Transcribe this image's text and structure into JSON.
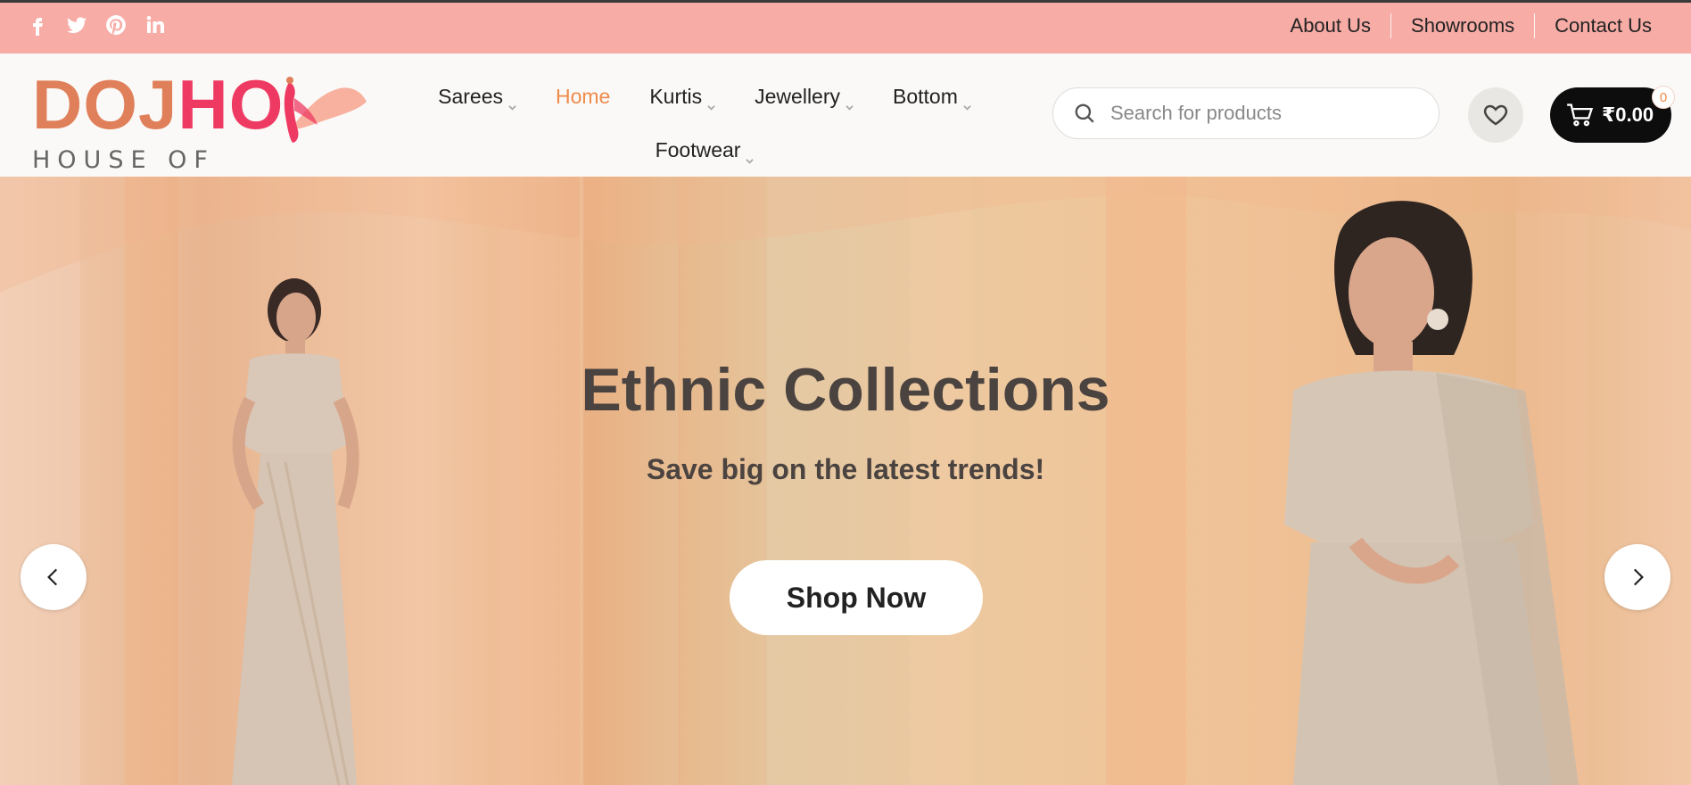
{
  "social": [
    "facebook-icon",
    "twitter-icon",
    "pinterest-icon",
    "linkedin-icon"
  ],
  "toplinks": [
    "About Us",
    "Showrooms",
    "Contact Us"
  ],
  "logo": {
    "main_part1": "DOJ",
    "main_part2": "HO",
    "subtitle": "HOUSE OF FASHION"
  },
  "nav": {
    "row1": [
      "Sarees",
      "Home",
      "Kurtis",
      "Jewellery",
      "Bottom"
    ],
    "row2": [
      "Footwear"
    ],
    "active": "Home"
  },
  "search": {
    "placeholder": "Search for products"
  },
  "cart": {
    "amount": "₹0.00",
    "count": "0"
  },
  "hero": {
    "title": "Ethnic Collections",
    "subtitle": "Save big on the latest trends!",
    "cta": "Shop Now"
  },
  "colors": {
    "topbar": "#f7aca6",
    "accent": "#f08a4b",
    "logo_orange": "#e0805a",
    "logo_pink": "#ee3a62"
  }
}
